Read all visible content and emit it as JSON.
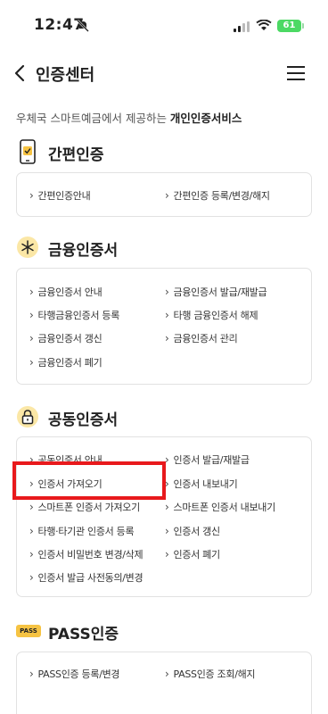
{
  "status": {
    "time": "12:47",
    "battery": "61"
  },
  "nav": {
    "title": "인증센터"
  },
  "intro": {
    "prefix": "우체국 스마트예금에서 제공하는 ",
    "emphasis": "개인인증서비스"
  },
  "sections": [
    {
      "title": "간편인증",
      "icon": "phone-check-icon",
      "links": [
        "간편인증안내",
        "간편인증 등록/변경/해지"
      ]
    },
    {
      "title": "금융인증서",
      "icon": "asterisk-icon",
      "links": [
        "금융인증서 안내",
        "금융인증서 발급/재발급",
        "타행금융인증서 등록",
        "타행 금융인증서 해제",
        "금융인증서 갱신",
        "금융인증서 관리",
        "금융인증서 폐기"
      ]
    },
    {
      "title": "공동인증서",
      "icon": "lock-icon",
      "links": [
        "공동인증서 안내",
        "인증서 발급/재발급",
        "인증서 가져오기",
        "인증서 내보내기",
        "스마트폰 인증서 가져오기",
        "스마트폰 인증서 내보내기",
        "타행·타기관 인증서 등록",
        "인증서 갱신",
        "인증서 비밀번호 변경/삭제",
        "인증서 폐기",
        "인증서 발급 사전동의/변경"
      ]
    },
    {
      "title": "PASS인증",
      "icon": "pass-badge-icon",
      "badge": "PASS",
      "links": [
        "PASS인증 등록/변경",
        "PASS인증 조회/해지"
      ]
    }
  ],
  "colors": {
    "accent": "#f6c343",
    "highlight": "#e8191c",
    "battery": "#4cd964"
  }
}
